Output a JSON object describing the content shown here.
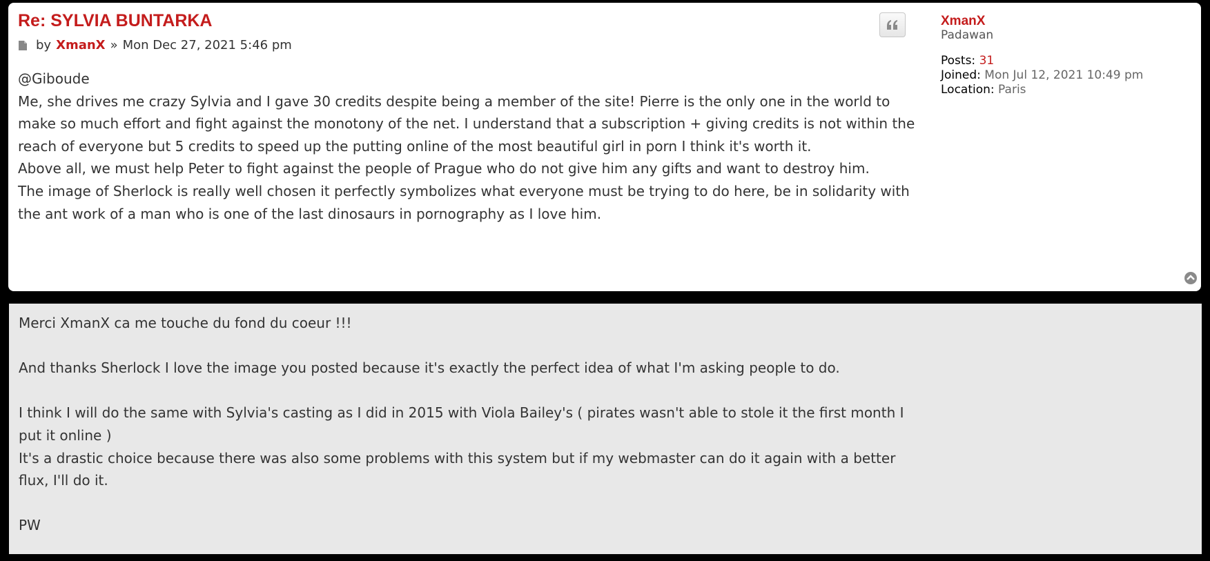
{
  "post": {
    "title": "Re: SYLVIA BUNTARKA",
    "by_label": "by",
    "author": "XmanX",
    "separator": "»",
    "date": "Mon Dec 27, 2021 5:46 pm",
    "content": [
      "@Giboude",
      "Me, she drives me crazy Sylvia and I gave 30 credits despite being a member of the site! Pierre is the only one in the world to make so much effort and fight against the monotony of the net. I understand that a subscription + giving credits is not within the reach of everyone but 5 credits to speed up the putting online of the most beautiful girl in porn I think it's worth it.",
      "Above all, we must help Peter to fight against the people of Prague who do not give him any gifts and want to destroy him.",
      "The image of Sherlock is really well chosen it perfectly symbolizes what everyone must be trying to do here, be in solidarity with the ant work of a man who is one of the last dinosaurs in pornography as I love him."
    ],
    "profile": {
      "name": "XmanX",
      "rank": "Padawan",
      "posts_label": "Posts:",
      "posts_value": "31",
      "joined_label": "Joined:",
      "joined_value": "Mon Jul 12, 2021 10:49 pm",
      "location_label": "Location:",
      "location_value": "Paris"
    }
  },
  "reply": {
    "lines": [
      "Merci XmanX ca me touche du fond du coeur !!!",
      "",
      "And thanks Sherlock I love the image you posted because it's exactly the perfect idea of what I'm asking people to do.",
      "",
      "I think I will do the same with Sylvia's casting as I did in 2015 with Viola Bailey's ( pirates wasn't able to stole it the first month I put it online )",
      "It's a drastic choice because there was also some problems with this system but if my webmaster can do it again with a better flux, I'll do it.",
      "",
      "PW"
    ]
  },
  "icons": {
    "post": "file-icon",
    "quote": "quote-icon",
    "top": "back-to-top-icon"
  },
  "colors": {
    "accent": "#c41c1c",
    "post_bg": "#ffffff",
    "reply_bg": "#e8e8e8",
    "page_bg": "#000000"
  }
}
